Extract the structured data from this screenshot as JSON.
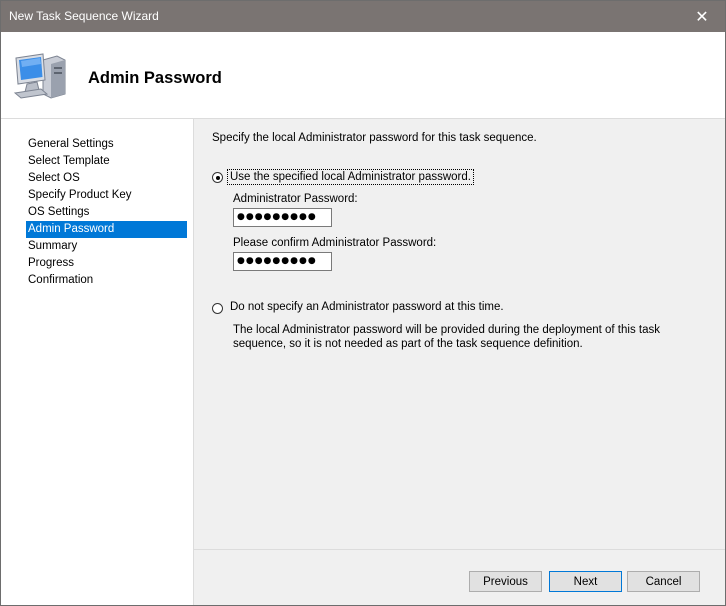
{
  "window": {
    "title": "New Task Sequence Wizard"
  },
  "header": {
    "page_title": "Admin Password"
  },
  "sidebar": {
    "items": [
      {
        "label": "General Settings"
      },
      {
        "label": "Select Template"
      },
      {
        "label": "Select OS"
      },
      {
        "label": "Specify Product Key"
      },
      {
        "label": "OS Settings"
      },
      {
        "label": "Admin Password",
        "active": true
      },
      {
        "label": "Summary"
      },
      {
        "label": "Progress"
      },
      {
        "label": "Confirmation"
      }
    ]
  },
  "main": {
    "intro": "Specify the local Administrator password for this task sequence.",
    "option_specify": {
      "label": "Use the specified local Administrator password.",
      "selected": true,
      "admin_password_label": "Administrator Password:",
      "admin_password_value": "●●●●●●●●●",
      "confirm_password_label": "Please confirm Administrator Password:",
      "confirm_password_value": "●●●●●●●●●"
    },
    "option_none": {
      "label": "Do not specify an Administrator password at this time.",
      "selected": false,
      "description": "The local Administrator password will be provided during the deployment of this task sequence, so it is not needed as part of the task sequence definition."
    }
  },
  "footer": {
    "previous_label": "Previous",
    "next_label": "Next",
    "cancel_label": "Cancel"
  },
  "colors": {
    "titlebar": "#7a7472",
    "selection": "#0078d7"
  }
}
